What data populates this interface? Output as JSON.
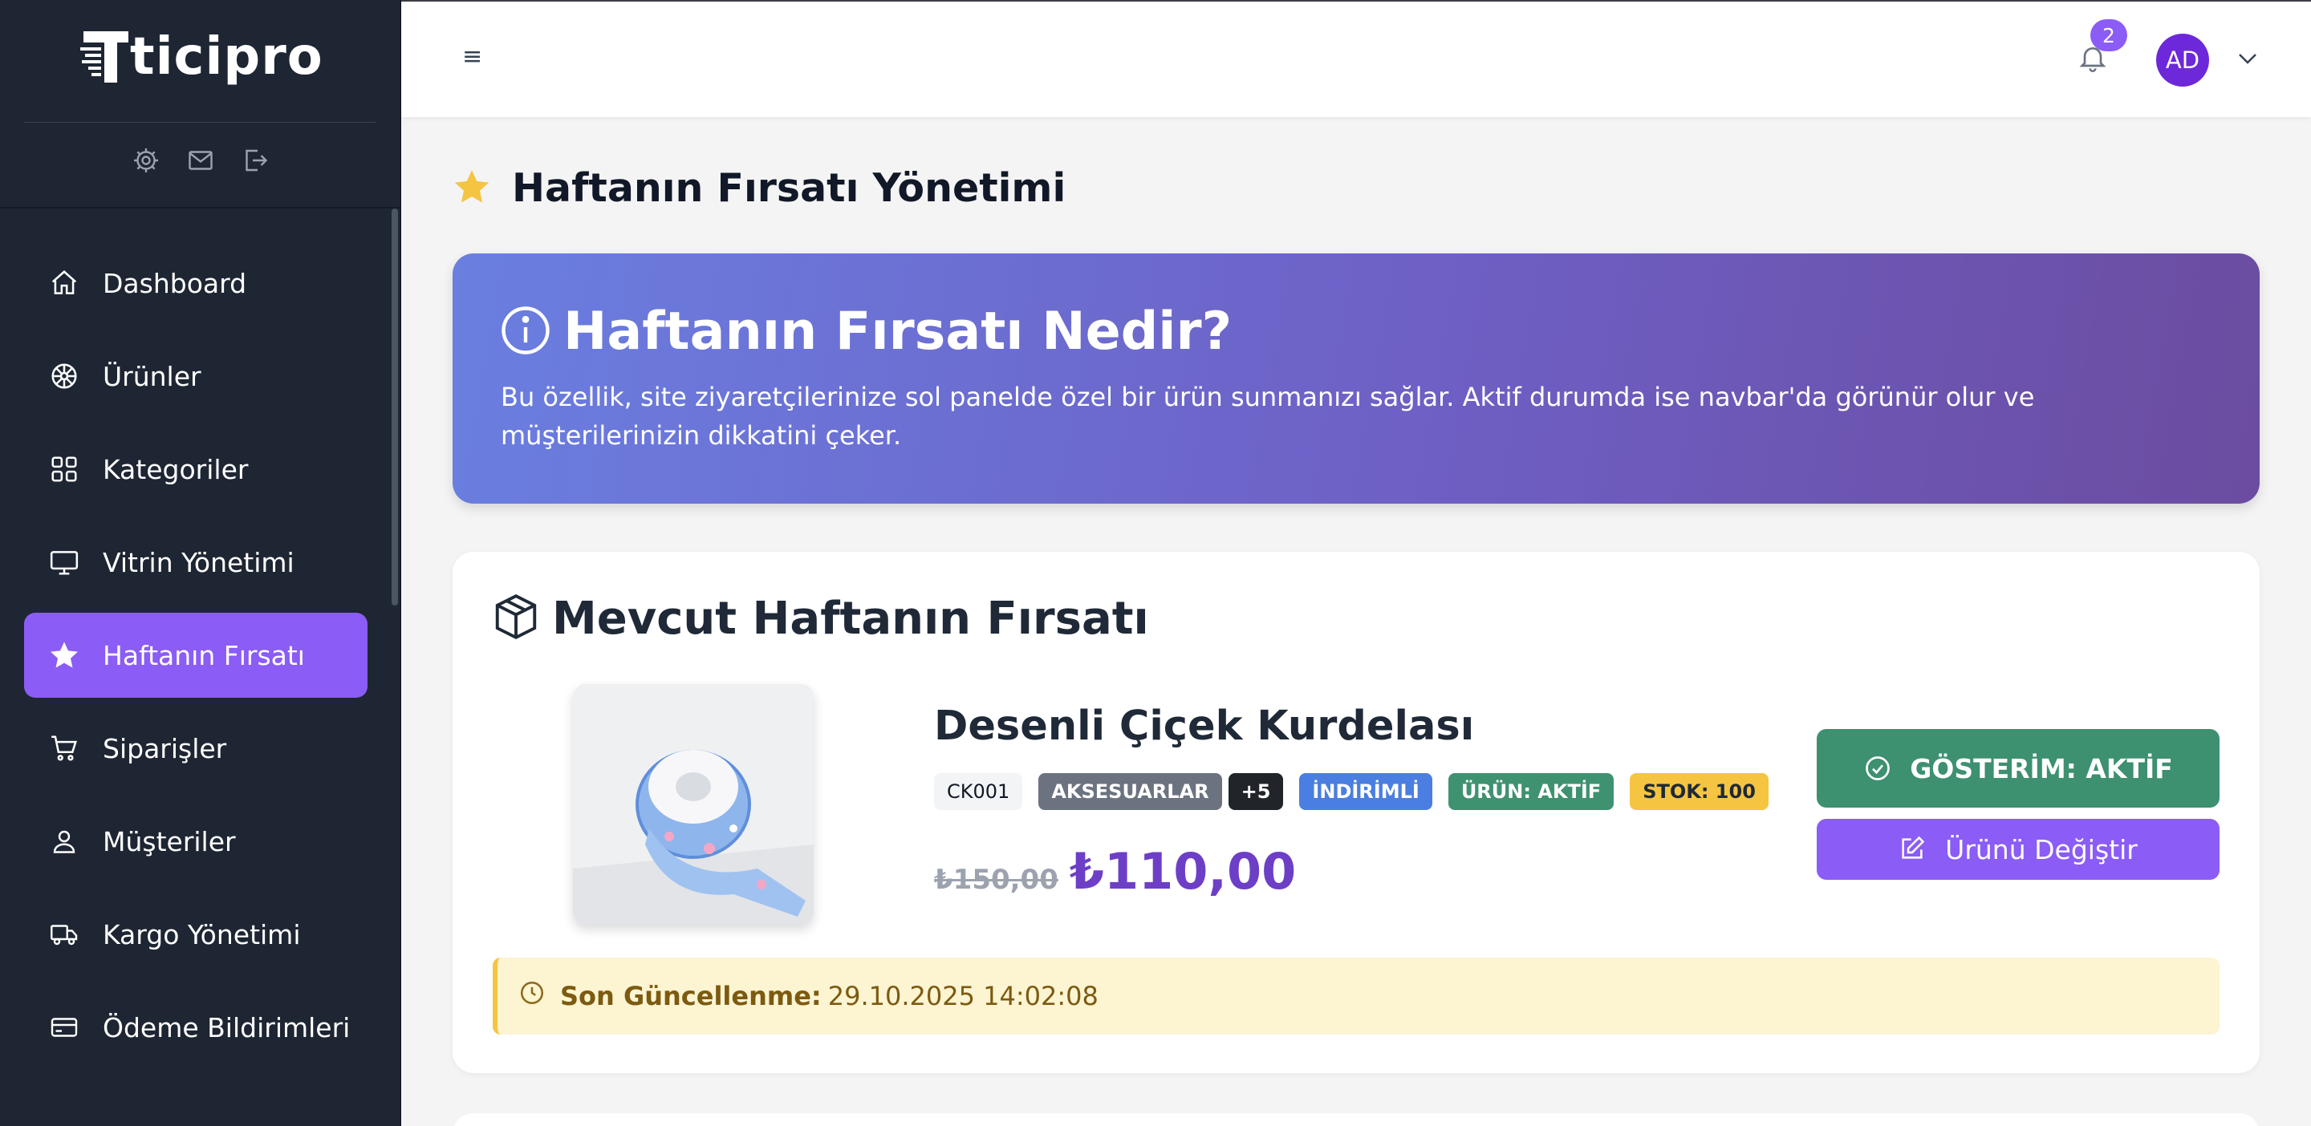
{
  "brand": {
    "name": "ticipro",
    "accent": "#8b5cf6"
  },
  "sidebar": {
    "quick_icons": [
      "gear-icon",
      "mail-icon",
      "logout-icon"
    ],
    "items": [
      {
        "label": "Dashboard",
        "icon": "home-icon",
        "active": false
      },
      {
        "label": "Ürünler",
        "icon": "flower-icon",
        "active": false
      },
      {
        "label": "Kategoriler",
        "icon": "grid-icon",
        "active": false
      },
      {
        "label": "Vitrin Yönetimi",
        "icon": "monitor-icon",
        "active": false
      },
      {
        "label": "Haftanın Fırsatı",
        "icon": "star-icon",
        "active": true
      },
      {
        "label": "Siparişler",
        "icon": "cart-icon",
        "active": false
      },
      {
        "label": "Müşteriler",
        "icon": "user-icon",
        "active": false
      },
      {
        "label": "Kargo Yönetimi",
        "icon": "truck-icon",
        "active": false
      },
      {
        "label": "Ödeme Bildirimleri",
        "icon": "credit-card-icon",
        "active": false
      }
    ]
  },
  "topbar": {
    "menu_glyph": "≡",
    "notification_count": "2",
    "avatar_initials": "AD"
  },
  "page": {
    "title": "Haftanın Fırsatı Yönetimi"
  },
  "info": {
    "title": "Haftanın Fırsatı Nedir?",
    "text": "Bu özellik, site ziyaretçilerinize sol panelde özel bir ürün sunmanızı sağlar. Aktif durumda ise navbar'da görünür olur ve müşterilerinizin dikkatini çeker."
  },
  "deal": {
    "section_title": "Mevcut Haftanın Fırsatı",
    "product_name": "Desenli Çiçek Kurdelası",
    "tags": {
      "code": "CK001",
      "category": "AKSESUARLAR",
      "more": "+5",
      "discount": "İNDİRİMLİ",
      "status": "ÜRÜN: AKTİF",
      "stock": "STOK: 100"
    },
    "old_price": "₺150,00",
    "new_price": "₺110,00",
    "show_button": "GÖSTERİM: AKTİF",
    "change_button": "Ürünü Değiştir",
    "update_label": "Son Güncellenme:",
    "update_value": "29.10.2025 14:02:08"
  }
}
